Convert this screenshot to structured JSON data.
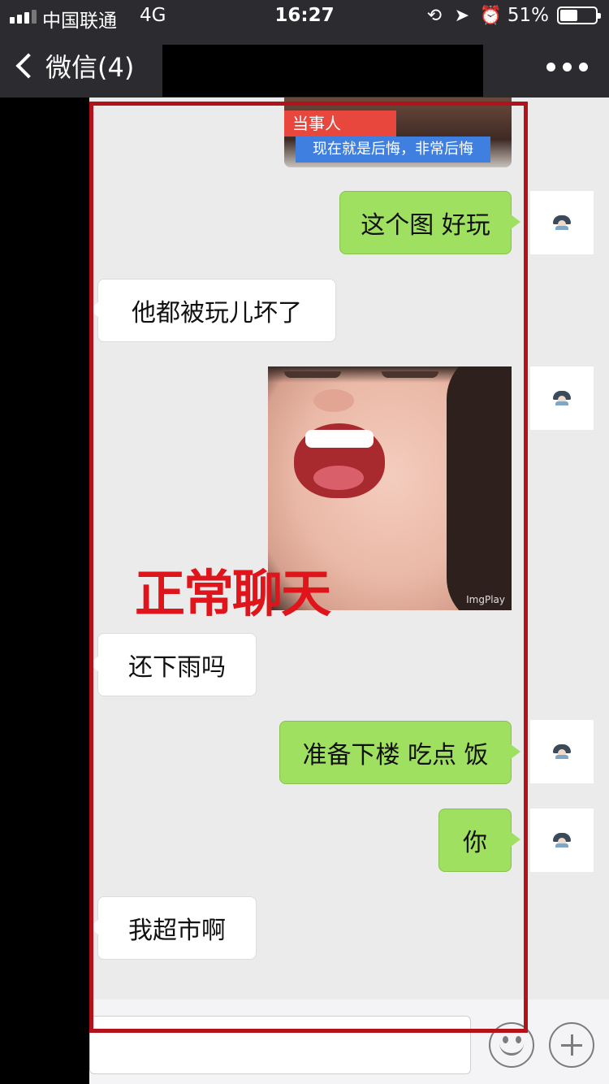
{
  "status_bar": {
    "carrier": "中国联通",
    "network": "4G",
    "time": "16:27",
    "battery_text": "51%",
    "battery_level": 0.51,
    "icons": [
      "signal-icon",
      "orientation-lock-icon",
      "location-icon",
      "alarm-icon",
      "battery-icon"
    ]
  },
  "nav": {
    "back_label": "微信(4)",
    "title_redacted": true
  },
  "messages": [
    {
      "side": "right",
      "type": "image",
      "caption_tag": "当事人",
      "caption_text": "现在就是后悔，非常后悔"
    },
    {
      "side": "right",
      "type": "text",
      "text": "这个图 好玩"
    },
    {
      "side": "left",
      "type": "text",
      "text": "他都被玩儿坏了"
    },
    {
      "side": "right",
      "type": "image",
      "watermark": "ImgPlay"
    },
    {
      "side": "left",
      "type": "text",
      "text": "还下雨吗"
    },
    {
      "side": "right",
      "type": "text",
      "text": "准备下楼 吃点 饭"
    },
    {
      "side": "right",
      "type": "text",
      "text": "你"
    },
    {
      "side": "left",
      "type": "text",
      "text": "我超市啊"
    }
  ],
  "overlay_label": "正常聊天",
  "colors": {
    "nav_bg": "#2c2c30",
    "my_bubble": "#9fe060",
    "their_bubble": "#ffffff",
    "annotation_red": "#e0141b",
    "frame_red": "#b3121b"
  }
}
